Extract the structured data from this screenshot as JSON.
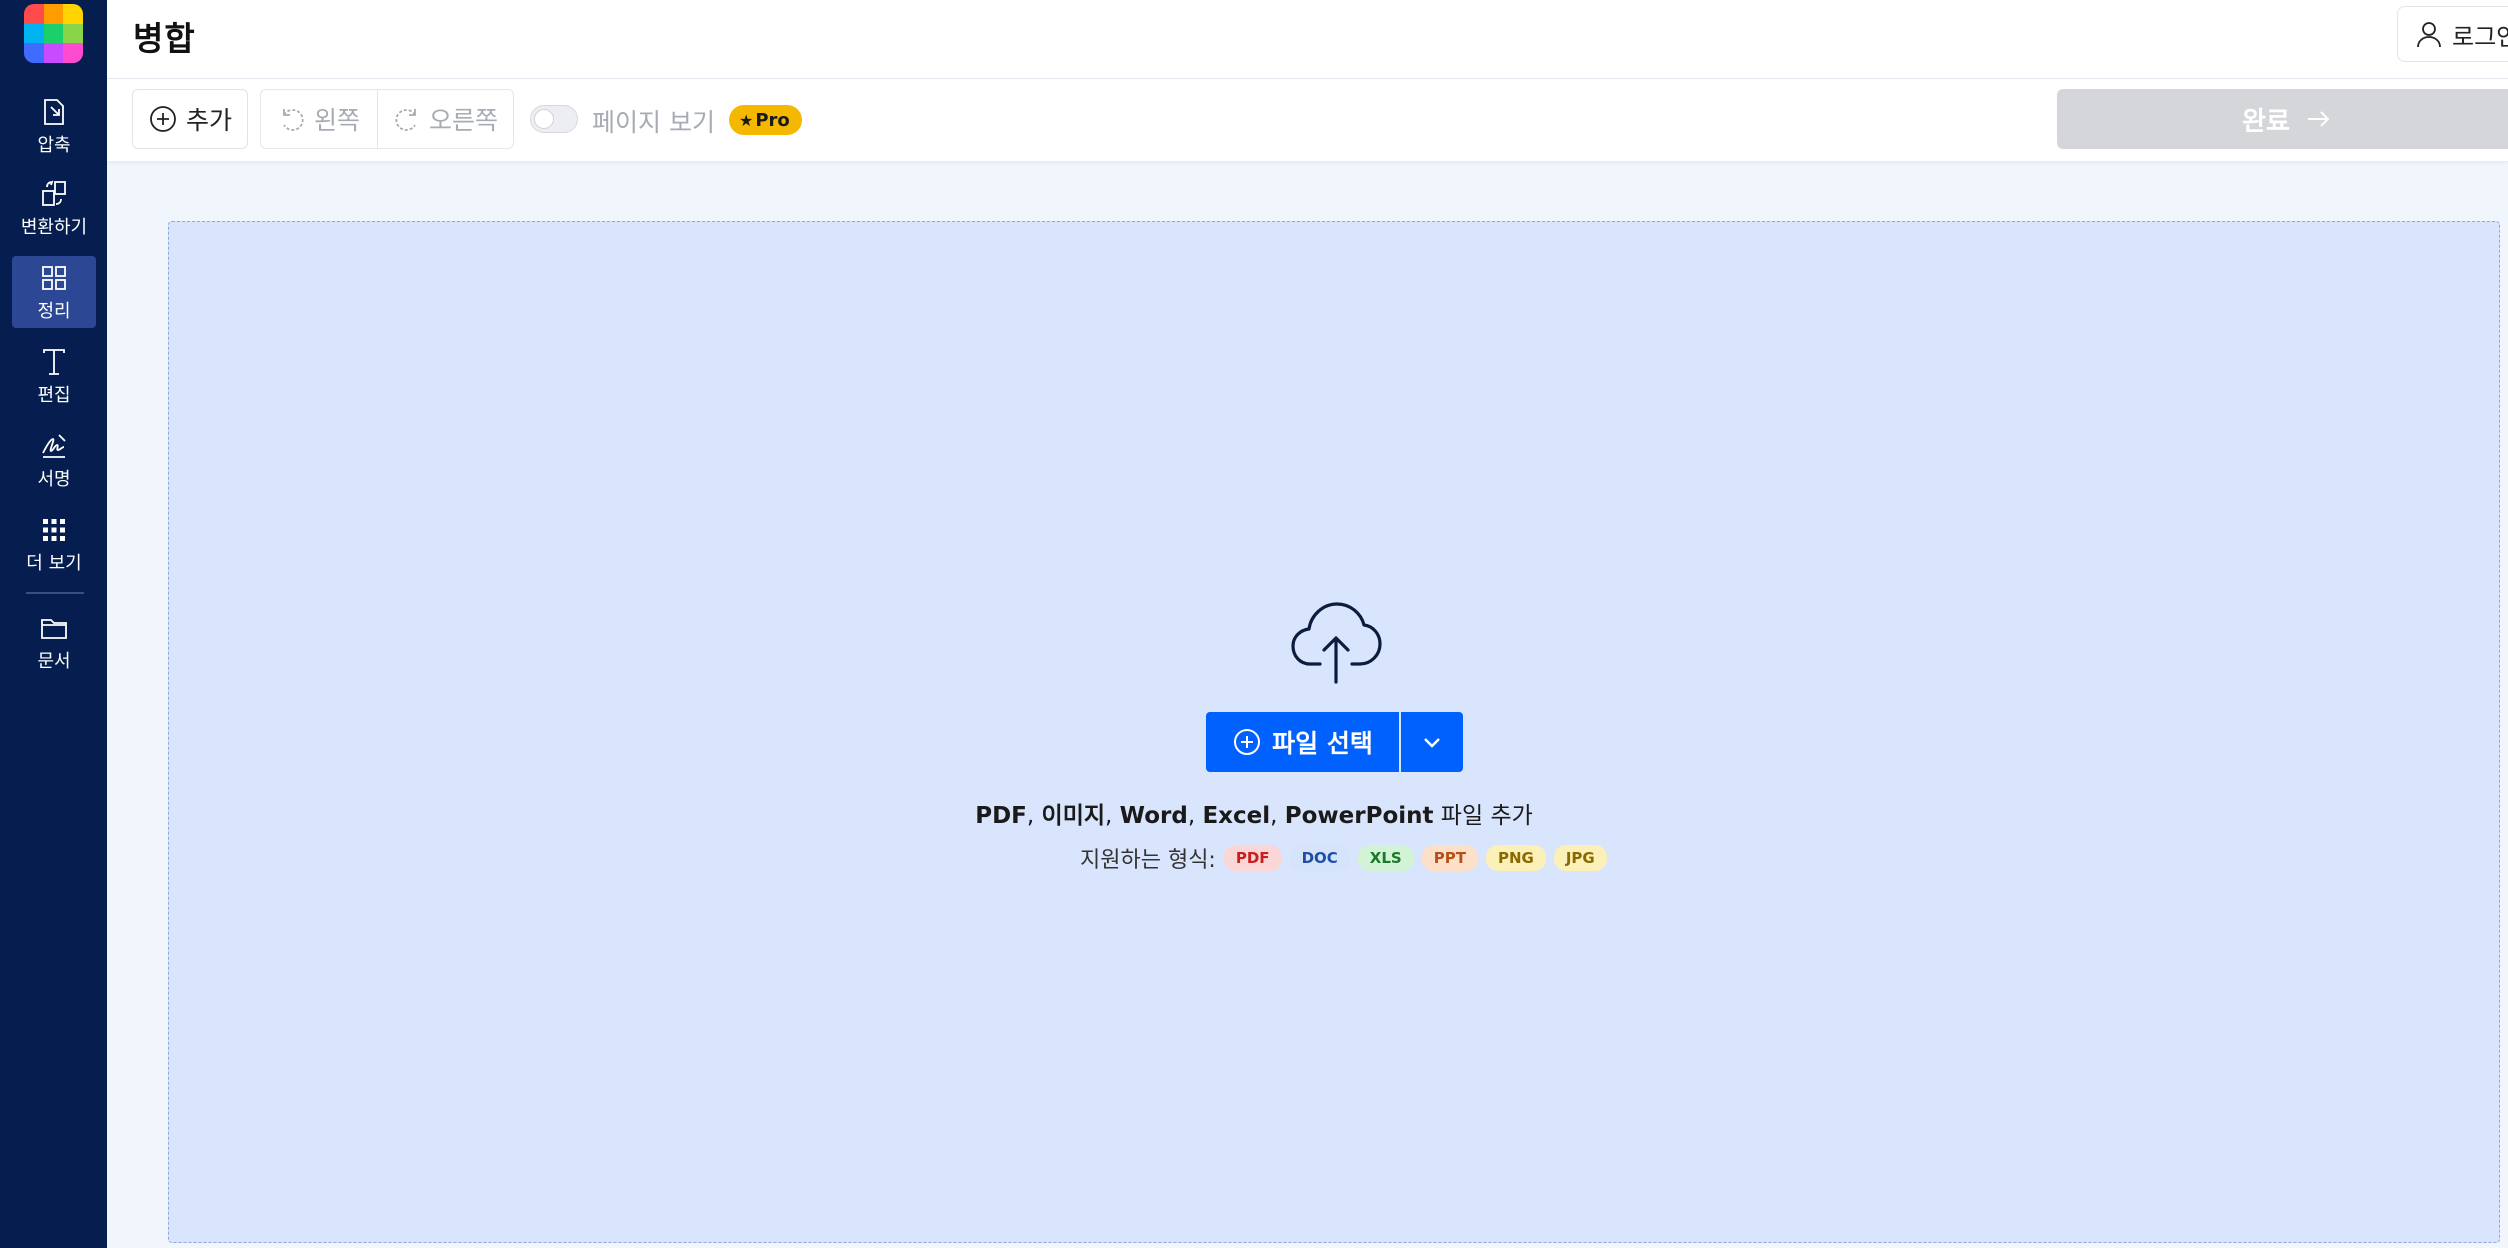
{
  "sidebar": {
    "items": [
      {
        "label": "압축",
        "icon": "compress-icon"
      },
      {
        "label": "변환하기",
        "icon": "convert-icon"
      },
      {
        "label": "정리",
        "icon": "organize-icon",
        "active": true
      },
      {
        "label": "편집",
        "icon": "edit-text-icon"
      },
      {
        "label": "서명",
        "icon": "signature-icon"
      },
      {
        "label": "더 보기",
        "icon": "more-grid-icon"
      },
      {
        "label": "문서",
        "icon": "folder-icon"
      }
    ],
    "logo_icon": "app-logo-icon",
    "logo_colors": [
      "#ff4b4b",
      "#ff9d00",
      "#ffd400",
      "#00b3f0",
      "#1bcf6b",
      "#8ad44a",
      "#3f6bff",
      "#c94bff",
      "#ff4bd1"
    ]
  },
  "header": {
    "title": "병합",
    "login_label": "로그인",
    "login_icon": "user-icon"
  },
  "toolbar": {
    "add_label": "추가",
    "rotate_left_label": "왼쪽",
    "rotate_right_label": "오른쪽",
    "page_view_label": "페이지 보기",
    "pro_label": "Pro",
    "done_label": "완료",
    "page_view_on": false
  },
  "dropzone": {
    "upload_icon": "cloud-upload-icon",
    "select_label": "파일 선택",
    "add_text_parts": [
      {
        "text": "PDF",
        "bold": true
      },
      {
        "text": ", ",
        "bold": false
      },
      {
        "text": "이미지",
        "bold": true
      },
      {
        "text": ", ",
        "bold": false
      },
      {
        "text": "Word",
        "bold": true
      },
      {
        "text": ", ",
        "bold": false
      },
      {
        "text": "Excel",
        "bold": true
      },
      {
        "text": ", ",
        "bold": false
      },
      {
        "text": "PowerPoint",
        "bold": true
      },
      {
        "text": " 파일 추가",
        "bold": false
      }
    ],
    "formats_label": "지원하는 형식:",
    "formats": [
      {
        "label": "PDF",
        "bg": "#fbd6d6",
        "fg": "#c81e1e"
      },
      {
        "label": "DOC",
        "bg": "#d6e4fb",
        "fg": "#1e4fa8"
      },
      {
        "label": "XLS",
        "bg": "#d3f3d6",
        "fg": "#1a7a2a"
      },
      {
        "label": "PPT",
        "bg": "#fde0c7",
        "fg": "#b6501a"
      },
      {
        "label": "PNG",
        "bg": "#fbf0b8",
        "fg": "#8a6a00"
      },
      {
        "label": "JPG",
        "bg": "#fbf0b8",
        "fg": "#8a6a00"
      }
    ]
  },
  "colors": {
    "sidebar_bg": "#061e4f",
    "accent": "#0061ff",
    "pro_badge": "#f5b800",
    "dropzone_bg": "#d9e5fc"
  }
}
